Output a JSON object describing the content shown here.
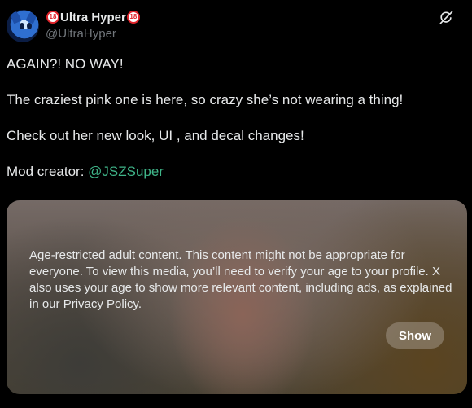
{
  "post": {
    "author": {
      "display_name_prefix_badge": "18",
      "display_name": "Ultra Hyper",
      "display_name_suffix_badge": "18",
      "handle": "@UltraHyper"
    },
    "text": {
      "line1": "AGAIN?! NO WAY!",
      "line2": "The craziest pink one is here, so crazy she’s not wearing a thing!",
      "line3": "Check out her new look, UI , and decal changes!",
      "line4_prefix": "Mod creator: ",
      "line4_mention": "@JSZSuper"
    },
    "media": {
      "notice": "Age-restricted adult content. This content might not be appropriate for everyone. To view this media, you’ll need to verify your age to your profile. X also uses your age to show more relevant content, including ads, as explained in our Privacy Policy.",
      "show_label": "Show"
    }
  },
  "icons": {
    "header_action": "grok-icon"
  },
  "colors": {
    "background": "#000000",
    "text": "#e7e9ea",
    "secondary_text": "#71767b",
    "mention": "#3fb589",
    "badge_red": "#e0242b"
  }
}
